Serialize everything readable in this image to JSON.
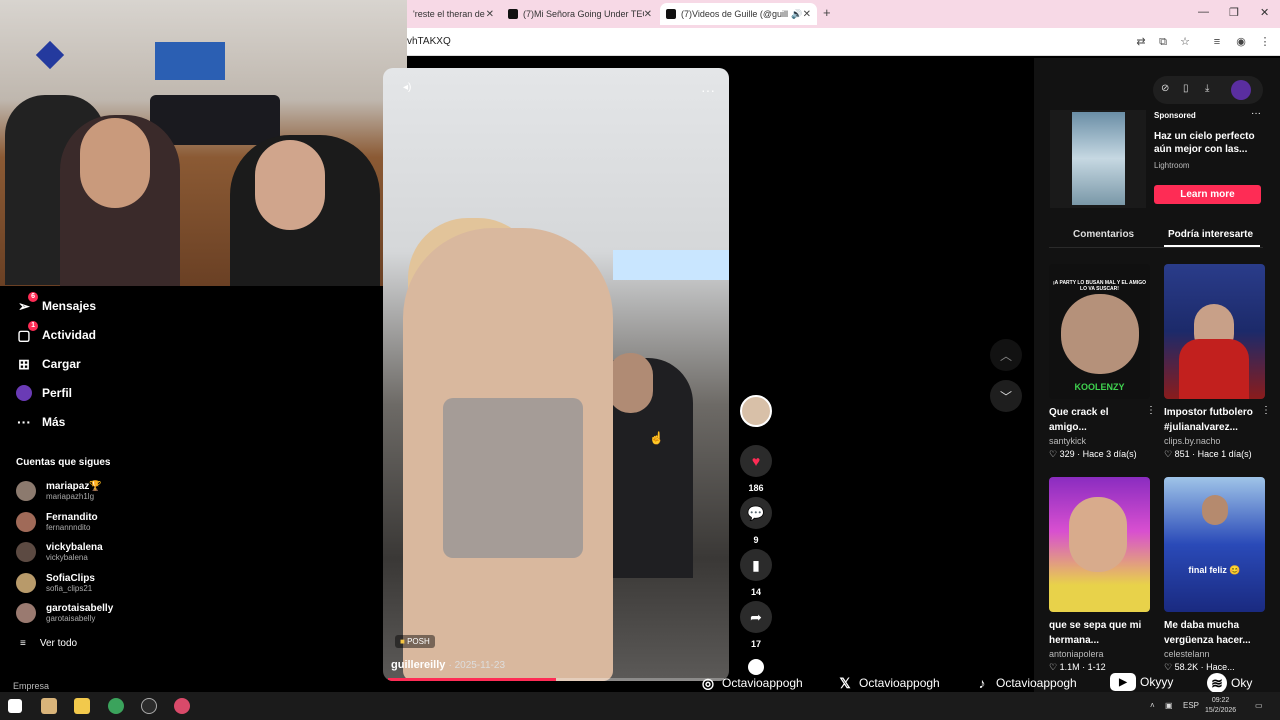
{
  "browser": {
    "tabs": [
      {
        "label": "'reste el theran de",
        "active": false
      },
      {
        "label": "(7)Mi Señora Going Under TEC",
        "active": false
      },
      {
        "label": "(7)Videos de Guille (@guille",
        "active": true
      }
    ],
    "new_tab_icon": "+",
    "url": "vhTAKXQ",
    "window_controls": [
      "—",
      "❐",
      "✕"
    ]
  },
  "sidebar": {
    "nav": [
      {
        "label": "Mensajes",
        "icon": "send-icon",
        "badge": "6"
      },
      {
        "label": "Actividad",
        "icon": "inbox-icon",
        "badge": "1"
      },
      {
        "label": "Cargar",
        "icon": "upload-icon",
        "badge": ""
      },
      {
        "label": "Perfil",
        "icon": "profile-icon",
        "badge": ""
      },
      {
        "label": "Más",
        "icon": "more-icon",
        "badge": ""
      }
    ],
    "following_heading": "Cuentas que sigues",
    "following": [
      {
        "name": "mariapaz🏆",
        "user": "mariapazh1lg"
      },
      {
        "name": "Fernandito",
        "user": "fernannndito"
      },
      {
        "name": "vickybalena",
        "user": "vickybalena"
      },
      {
        "name": "SofiaClips",
        "user": "sofia_clips21"
      },
      {
        "name": "garotaisabelly",
        "user": "garotaisabelly"
      }
    ],
    "see_all": "Ver todo",
    "footer": "Empresa"
  },
  "video": {
    "author": "guillereilly",
    "date": "· 2025-11-23",
    "tag": "POSH",
    "progress": 0.5,
    "likes": "186",
    "comments": "9",
    "saves": "14",
    "shares": "17"
  },
  "right_panel": {
    "sponsored_label": "Sponsored",
    "ad_title": "Haz un cielo perfecto aún mejor con las...",
    "ad_source": "Lightroom",
    "ad_button": "Learn more",
    "tabs": [
      "Comentarios",
      "Podría interesarte"
    ],
    "cards": [
      {
        "title": "Que crack el amigo...",
        "author": "santykick",
        "likes": "♡ 329",
        "time": "· Hace 3 día(s)",
        "thumb_text": "¡A PARTY LO BUSAN MAL Y EL AMIGO LO VA SUSCAR!",
        "thumb_text2": "KOOLENZY"
      },
      {
        "title": "Impostor futbolero #julianalvarez...",
        "author": "clips.by.nacho",
        "likes": "♡ 851",
        "time": "· Hace 1 día(s)",
        "thumb_text": "",
        "thumb_text2": ""
      },
      {
        "title": "que se sepa que mi hermana...",
        "author": "antoniapolera",
        "likes": "♡ 1.1M",
        "time": "· 1-12",
        "thumb_text": "",
        "thumb_text2": ""
      },
      {
        "title": "Me daba mucha vergüenza hacer...",
        "author": "celestelann",
        "likes": "♡ 58.2K",
        "time": "· Hace...",
        "thumb_text": "final feliz 😊",
        "thumb_text2": ""
      }
    ]
  },
  "socials": [
    {
      "icon": "instagram-icon",
      "glyph": "◎",
      "label": "Octavioappogh"
    },
    {
      "icon": "x-icon",
      "glyph": "𝕏",
      "label": "Octavioappogh"
    },
    {
      "icon": "tiktok-icon",
      "glyph": "♪",
      "label": "Octavioappogh"
    },
    {
      "icon": "youtube-icon",
      "glyph": "▶",
      "label": "Okyyy"
    },
    {
      "icon": "spotify-icon",
      "glyph": "≋",
      "label": "Oky"
    }
  ],
  "taskbar": {
    "lang": "ESP",
    "time": "09:22",
    "date": "15/2/2026"
  },
  "colors": {
    "accent": "#fe2c55",
    "tab_bar": "#f7d9e6"
  }
}
